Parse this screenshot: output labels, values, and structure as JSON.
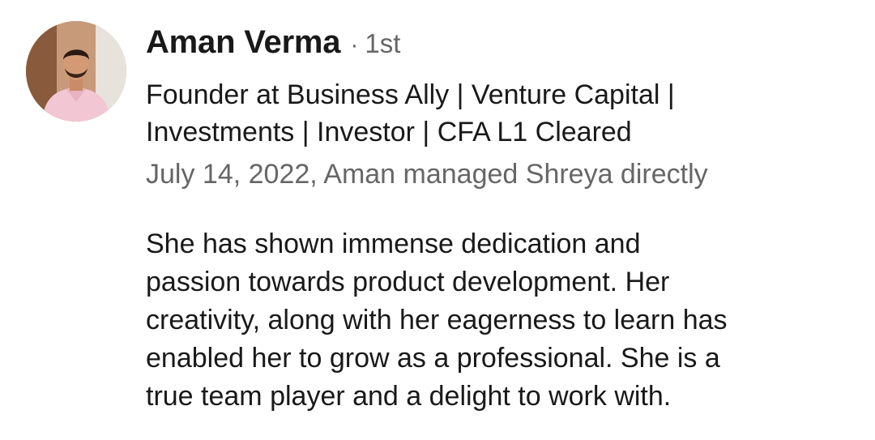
{
  "recommendation": {
    "author": {
      "name": "Aman Verma",
      "separator": "·",
      "connection_degree": "1st",
      "headline_line1": "Founder at Business Ally | Venture Capital |",
      "headline_line2": "Investments | Investor | CFA L1 Cleared",
      "avatar_icon": "profile-photo"
    },
    "meta": "July 14, 2022, Aman managed Shreya directly",
    "text_lines": [
      "She has shown immense dedication and",
      "passion towards product development. Her",
      "creativity, along with her eagerness to learn has",
      "enabled her to grow as a professional. She is a",
      "true team player and a delight to work with."
    ]
  },
  "colors": {
    "primary_text": "#191919",
    "secondary_text": "#666666",
    "background": "#ffffff"
  }
}
